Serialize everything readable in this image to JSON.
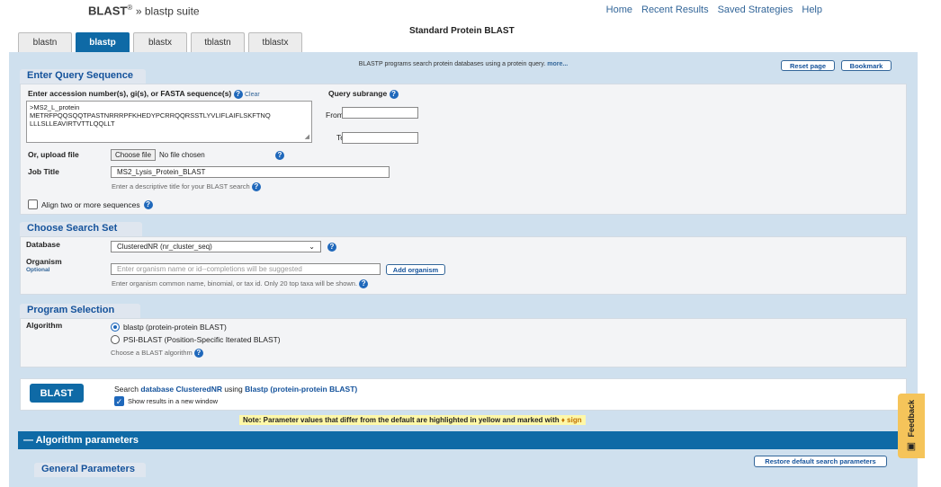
{
  "header": {
    "title": "BLAST",
    "sup": "®",
    "crumb": "» blastp suite",
    "links": [
      "Home",
      "Recent Results",
      "Saved Strategies",
      "Help"
    ],
    "page_heading": "Standard Protein BLAST"
  },
  "tabs": [
    "blastn",
    "blastp",
    "blastx",
    "tblastn",
    "tblastx"
  ],
  "active_tab": "blastp",
  "description": "BLASTP programs search protein databases using a protein query.",
  "more_link": "more...",
  "reset_button": "Reset page",
  "bookmark_button": "Bookmark",
  "query": {
    "section": "Enter Query Sequence",
    "label": "Enter accession number(s), gi(s), or FASTA sequence(s)",
    "clear": "Clear",
    "subrange_label": "Query subrange",
    "from": "From",
    "to": "To",
    "sequence_lines": [
      ">MS2_L_protein",
      "METRFPQQSQQTPASTNRRRPFKHEDYPCRRQQRSSTLYVLIFLAIFLSKFTNQ",
      "LLLSLLEAVIRTVTTLQQLLT"
    ],
    "upload_label": "Or, upload file",
    "choose_file": "Choose file",
    "no_file": "No file chosen",
    "job_title_label": "Job Title",
    "job_title_value": "MS2_Lysis_Protein_BLAST",
    "job_title_hint": "Enter a descriptive title for your BLAST search",
    "align_two": "Align two or more sequences"
  },
  "search_set": {
    "section": "Choose Search Set",
    "database_label": "Database",
    "database_value": "ClusteredNR (nr_cluster_seq)",
    "organism_label": "Organism",
    "optional": "Optional",
    "organism_placeholder": "Enter organism name or id--completions will be suggested",
    "add_organism": "Add organism",
    "organism_hint": "Enter organism common name, binomial, or tax id. Only 20 top taxa will be shown."
  },
  "program": {
    "section": "Program Selection",
    "algorithm_label": "Algorithm",
    "option1": "blastp (protein-protein BLAST)",
    "option2": "PSI-BLAST (Position-Specific Iterated BLAST)",
    "choose_hint": "Choose a BLAST algorithm"
  },
  "submit": {
    "button": "BLAST",
    "text_prefix": "Search",
    "text_database": "database ClusteredNR",
    "text_using": "using",
    "text_algo": "Blastp (protein-protein BLAST)",
    "new_window": "Show results in a new window"
  },
  "note": "Note: Parameter values that differ from the default are highlighted in yellow and marked with",
  "note_sign": "♦ sign",
  "algorithm_params": "— Algorithm parameters",
  "restore_button": "Restore default search parameters",
  "general_params": "General Parameters",
  "feedback": "Feedback"
}
